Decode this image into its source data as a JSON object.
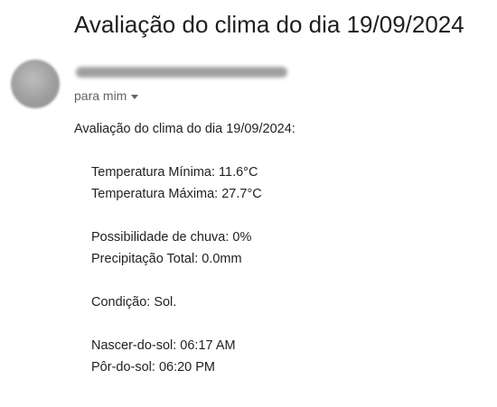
{
  "email": {
    "subject": "Avaliação do clima do dia 19/09/2024",
    "recipient_label": "para mim",
    "body": {
      "intro": "Avaliação do clima do dia 19/09/2024:",
      "temp_min": "Temperatura Mínima: 11.6°C",
      "temp_max": "Temperatura Máxima: 27.7°C",
      "rain_chance": "Possibilidade de chuva: 0%",
      "precipitation": "Precipitação Total: 0.0mm",
      "condition": "Condição: Sol.",
      "sunrise": "Nascer-do-sol: 06:17 AM",
      "sunset": "Pôr-do-sol: 06:20 PM"
    }
  },
  "icons": {
    "avatar": "avatar",
    "recipient_toggle": "chevron-down-icon"
  }
}
